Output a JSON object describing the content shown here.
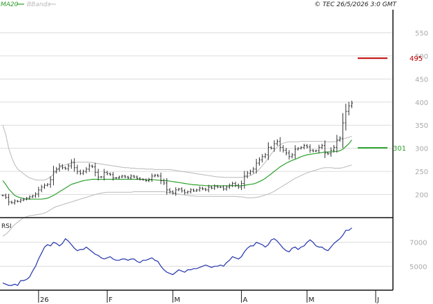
{
  "chart_data": {
    "type": "line",
    "colors": {
      "price": "#333333",
      "ma20": "#2ca02c",
      "bbands": "#b8b8b8",
      "resistance": "#c00000",
      "support": "#2ca02c",
      "grid": "#dcdcdc"
    },
    "legend": [
      "MA20",
      "BBands"
    ],
    "copyright": "© TEC 26/5/2026 3:0 GMT",
    "price_panel": {
      "ylim": [
        150,
        600
      ],
      "yticks": [
        200,
        250,
        300,
        350,
        400,
        450,
        500,
        550
      ],
      "ytick_labels": [
        "200",
        "250",
        "300",
        "350",
        "400",
        "450",
        "500",
        "550"
      ],
      "resistance": {
        "value": 495,
        "label": "495"
      },
      "support": {
        "value": 301,
        "label": "301"
      }
    },
    "rsi_panel": {
      "title": "RSI",
      "ylim": [
        30,
        90
      ],
      "yticks": [
        50,
        70
      ],
      "ytick_labels": [
        "5000",
        "7000"
      ]
    },
    "x_axis": {
      "months": [
        {
          "label": "26",
          "bar": 12
        },
        {
          "label": "F",
          "bar": 35
        },
        {
          "label": "M",
          "bar": 57
        },
        {
          "label": "A",
          "bar": 80
        },
        {
          "label": "M",
          "bar": 102
        },
        {
          "label": "J",
          "bar": 125
        }
      ],
      "total_bars": 128
    },
    "close": [
      198,
      194,
      184,
      182,
      186,
      185,
      188,
      190,
      192,
      195,
      197,
      201,
      210,
      216,
      220,
      222,
      232,
      250,
      255,
      262,
      258,
      256,
      262,
      270,
      258,
      250,
      246,
      250,
      255,
      262,
      260,
      248,
      238,
      238,
      248,
      245,
      243,
      236,
      236,
      238,
      240,
      238,
      236,
      240,
      238,
      235,
      233,
      232,
      230,
      233,
      240,
      242,
      240,
      230,
      225,
      210,
      206,
      203,
      210,
      212,
      208,
      204,
      206,
      210,
      208,
      210,
      214,
      212,
      210,
      216,
      214,
      218,
      216,
      216,
      212,
      216,
      220,
      224,
      220,
      216,
      224,
      240,
      246,
      250,
      255,
      268,
      275,
      282,
      286,
      302,
      300,
      310,
      315,
      302,
      296,
      290,
      282,
      286,
      298,
      300,
      302,
      306,
      303,
      296,
      294,
      295,
      302,
      306,
      290,
      288,
      296,
      302,
      318,
      322,
      355,
      380,
      392,
      398
    ],
    "ma20": [
      230,
      222,
      212,
      205,
      198,
      195,
      193,
      191,
      190,
      190,
      190,
      190,
      190,
      190,
      191,
      192,
      195,
      198,
      202,
      206,
      210,
      214,
      218,
      222,
      224,
      226,
      228,
      230,
      231,
      232,
      233,
      233,
      233,
      233,
      233,
      233,
      233,
      233,
      233,
      233,
      233,
      233,
      233,
      233,
      233,
      233,
      233,
      233,
      232,
      232,
      232,
      232,
      231,
      231,
      230,
      230,
      229,
      228,
      227,
      226,
      225,
      224,
      223,
      222,
      221,
      221,
      220,
      220,
      219,
      219,
      219,
      219,
      219,
      219,
      219,
      219,
      219,
      219,
      219,
      219,
      219,
      220,
      221,
      222,
      223,
      225,
      228,
      231,
      235,
      240,
      245,
      250,
      255,
      260,
      264,
      268,
      271,
      274,
      276,
      279,
      282,
      284,
      286,
      287,
      288,
      289,
      290,
      291,
      292,
      292,
      292,
      293,
      293,
      295,
      298,
      304,
      310,
      318
    ],
    "bb_upper": [
      350,
      330,
      300,
      280,
      265,
      255,
      250,
      245,
      240,
      236,
      234,
      232,
      231,
      231,
      232,
      234,
      238,
      244,
      252,
      258,
      262,
      264,
      266,
      268,
      269,
      270,
      270,
      270,
      270,
      270,
      269,
      268,
      267,
      266,
      265,
      264,
      263,
      262,
      261,
      260,
      259,
      258,
      258,
      257,
      257,
      256,
      256,
      256,
      255,
      255,
      255,
      254,
      254,
      254,
      254,
      254,
      254,
      253,
      252,
      251,
      250,
      249,
      248,
      247,
      246,
      245,
      244,
      243,
      242,
      241,
      240,
      239,
      238,
      238,
      237,
      237,
      237,
      237,
      237,
      237,
      237,
      238,
      239,
      241,
      244,
      249,
      255,
      262,
      270,
      279,
      288,
      296,
      303,
      308,
      311,
      313,
      314,
      314,
      314,
      314,
      315,
      315,
      315,
      315,
      315,
      315,
      315,
      315,
      314,
      314,
      314,
      314,
      315,
      318,
      320,
      322,
      324,
      326
    ],
    "bb_lower": [
      110,
      114,
      120,
      128,
      135,
      140,
      145,
      150,
      152,
      154,
      155,
      156,
      157,
      158,
      160,
      163,
      167,
      171,
      174,
      176,
      178,
      180,
      182,
      184,
      186,
      188,
      190,
      192,
      194,
      196,
      198,
      200,
      202,
      203,
      204,
      205,
      205,
      205,
      205,
      205,
      205,
      205,
      205,
      205,
      206,
      206,
      206,
      206,
      206,
      206,
      206,
      206,
      206,
      206,
      206,
      205,
      204,
      203,
      202,
      201,
      200,
      199,
      198,
      197,
      197,
      196,
      196,
      196,
      196,
      196,
      196,
      196,
      196,
      196,
      196,
      196,
      196,
      196,
      196,
      195,
      195,
      194,
      193,
      193,
      193,
      194,
      195,
      197,
      199,
      201,
      204,
      207,
      211,
      215,
      219,
      223,
      227,
      231,
      235,
      238,
      241,
      244,
      247,
      249,
      251,
      253,
      255,
      257,
      258,
      258,
      258,
      257,
      257,
      257,
      258,
      260,
      262,
      264
    ],
    "rsi": [
      36,
      35,
      34,
      34,
      35,
      34,
      38,
      38,
      39,
      41,
      46,
      50,
      56,
      61,
      66,
      68,
      67,
      70,
      69,
      67,
      69,
      73,
      71,
      68,
      65,
      63,
      64,
      64,
      66,
      64,
      62,
      60,
      59,
      57,
      56,
      57,
      58,
      56,
      55,
      55,
      56,
      56,
      55,
      56,
      56,
      54,
      53,
      55,
      55,
      56,
      57,
      55,
      54,
      50,
      47,
      45,
      44,
      43,
      45,
      47,
      46,
      45,
      47,
      47,
      48,
      48,
      49,
      50,
      51,
      50,
      49,
      50,
      50,
      51,
      50,
      53,
      55,
      58,
      57,
      56,
      58,
      62,
      65,
      67,
      67,
      70,
      69,
      68,
      66,
      68,
      72,
      73,
      71,
      68,
      65,
      63,
      62,
      65,
      66,
      64,
      66,
      67,
      70,
      72,
      70,
      67,
      66,
      66,
      64,
      63,
      66,
      69,
      71,
      73,
      76,
      80,
      80,
      82
    ]
  }
}
